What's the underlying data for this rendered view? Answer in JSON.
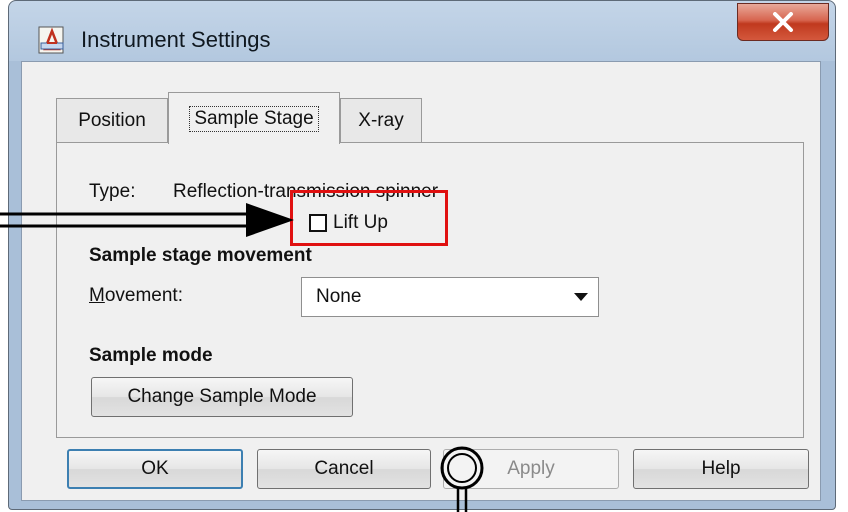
{
  "window": {
    "title": "Instrument Settings",
    "close_symbol": "X"
  },
  "tabs": [
    {
      "label": "Position",
      "active": false
    },
    {
      "label": "Sample Stage",
      "active": true
    },
    {
      "label": "X-ray",
      "active": false
    }
  ],
  "sample_stage": {
    "type_label": "Type:",
    "type_value": "Reflection-transmission spinner",
    "lift_up_label": "Lift Up",
    "lift_up_checked": false,
    "movement_group_title": "Sample stage movement",
    "movement_label_prefix": "M",
    "movement_label_rest": "ovement:",
    "movement_value": "None",
    "sample_mode_title": "Sample mode",
    "change_mode_label": "Change Sample Mode"
  },
  "footer": {
    "ok_label": "OK",
    "cancel_label": "Cancel",
    "apply_label": "Apply",
    "help_label": "Help"
  },
  "colors": {
    "highlight": "#e01010",
    "accent": "#3c7fb1"
  }
}
